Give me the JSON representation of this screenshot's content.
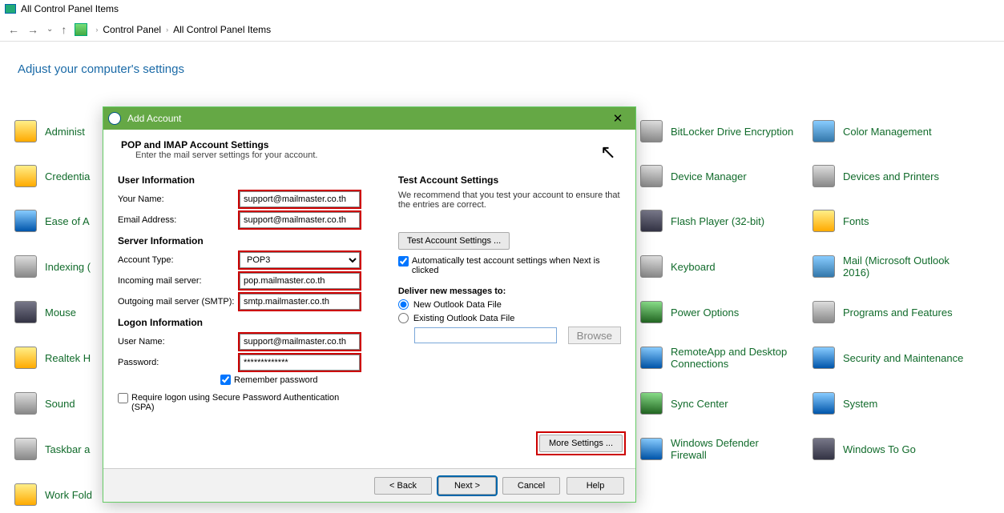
{
  "window": {
    "title": "All Control Panel Items"
  },
  "breadcrumb": {
    "root": "Control Panel",
    "current": "All Control Panel Items"
  },
  "heading": "Adjust your computer's settings",
  "bg_items": {
    "administ": "Administ",
    "credentia": "Credentia",
    "easeofa": "Ease of A",
    "indexing": "Indexing (",
    "mouse": "Mouse",
    "realtek": "Realtek H",
    "sound": "Sound",
    "taskbar": "Taskbar a",
    "workfold": "Work Fold",
    "bitlocker": "BitLocker Drive Encryption",
    "devicemgr": "Device Manager",
    "flash": "Flash Player (32-bit)",
    "keyboard": "Keyboard",
    "poweropt": "Power Options",
    "remote": "RemoteApp and Desktop Connections",
    "sync": "Sync Center",
    "defender": "Windows Defender Firewall",
    "colormgmt": "Color Management",
    "devprint": "Devices and Printers",
    "fonts": "Fonts",
    "mail": "Mail (Microsoft Outlook 2016)",
    "progfeat": "Programs and Features",
    "secmaint": "Security and Maintenance",
    "system": "System",
    "wintogo": "Windows To Go"
  },
  "dialog": {
    "title": "Add Account",
    "subtitle": "POP and IMAP Account Settings",
    "subdesc": "Enter the mail server settings for your account.",
    "close": "✕",
    "cursor": "↖",
    "left": {
      "userinfo_h": "User Information",
      "yourname_l": "Your Name:",
      "yourname_v": "support@mailmaster.co.th",
      "email_l": "Email Address:",
      "email_v": "support@mailmaster.co.th",
      "serverinfo_h": "Server Information",
      "accttype_l": "Account Type:",
      "accttype_v": "POP3",
      "inmail_l": "Incoming mail server:",
      "inmail_v": "pop.mailmaster.co.th",
      "outmail_l": "Outgoing mail server (SMTP):",
      "outmail_v": "smtp.mailmaster.co.th",
      "logon_h": "Logon Information",
      "user_l": "User Name:",
      "user_v": "support@mailmaster.co.th",
      "pass_l": "Password:",
      "pass_v": "*************",
      "remember": "Remember password",
      "spa": "Require logon using Secure Password Authentication (SPA)"
    },
    "right": {
      "test_h": "Test Account Settings",
      "test_desc": "We recommend that you test your account to ensure that the entries are correct.",
      "test_btn": "Test Account Settings ...",
      "auto_test": "Automatically test account settings when Next is clicked",
      "deliver_h": "Deliver new messages to:",
      "new_pst": "New Outlook Data File",
      "exist_pst": "Existing Outlook Data File",
      "browse": "Browse",
      "more": "More Settings ..."
    },
    "footer": {
      "back": "< Back",
      "next": "Next >",
      "cancel": "Cancel",
      "help": "Help"
    }
  }
}
